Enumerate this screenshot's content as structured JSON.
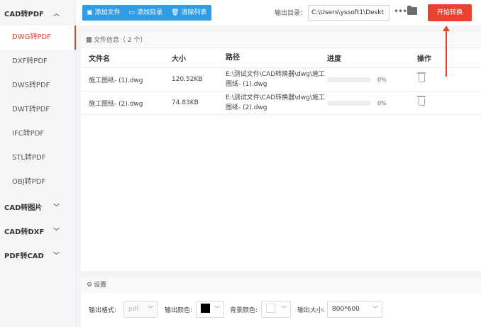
{
  "sidebar": {
    "groups": [
      {
        "label": "CAD转PDF",
        "expanded": true
      },
      {
        "label": "CAD转图片",
        "expanded": false
      },
      {
        "label": "CAD转DXF",
        "expanded": false
      },
      {
        "label": "PDF转CAD",
        "expanded": false
      }
    ],
    "items": [
      "DWG转PDF",
      "DXF转PDF",
      "DWS转PDF",
      "DWT转PDF",
      "IFC转PDF",
      "STL转PDF",
      "OBJ转PDF"
    ],
    "active_item": "DWG转PDF"
  },
  "toolbar": {
    "add_file": "添加文件",
    "add_folder": "添加目录",
    "clear_list": "清除列表",
    "output_label": "输出目录：",
    "output_path": "C:\\Users\\yssoft1\\Deskt",
    "start_button": "开始转换"
  },
  "file_panel": {
    "header": "文件信息（ 2 个）",
    "columns": [
      "文件名",
      "大小",
      "路径",
      "进度",
      "操作"
    ],
    "rows": [
      {
        "name": "施工图纸- (1).dwg",
        "size": "120.52KB",
        "path": "E:\\测试文件\\CAD转换器\\dwg\\施工图纸- (1).dwg",
        "progress": "0%"
      },
      {
        "name": "施工图纸- (2).dwg",
        "size": "74.83KB",
        "path": "E:\\测试文件\\CAD转换器\\dwg\\施工图纸- (2).dwg",
        "progress": "0%"
      }
    ]
  },
  "settings": {
    "header": "设置",
    "output_format_label": "输出格式:",
    "output_format_value": "pdf",
    "output_color_label": "输出颜色:",
    "output_color": "#000000",
    "bg_color_label": "背景颜色:",
    "bg_color": "#ffffff",
    "output_size_label": "输出大小:",
    "output_size_value": "800*600"
  },
  "colors": {
    "accent": "#e8432f",
    "toolbar_blue": "#2f9ce6"
  }
}
